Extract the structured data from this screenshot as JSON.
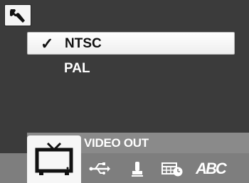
{
  "menu": {
    "options": [
      {
        "label": "NTSC",
        "selected": true,
        "check": "✓"
      },
      {
        "label": "PAL",
        "selected": false
      }
    ]
  },
  "infobar": {
    "label": "VIDEO OUT"
  },
  "tabs": [
    {
      "icon": "tv-icon",
      "active": true
    },
    {
      "icon": "usb-icon"
    },
    {
      "icon": "stamp-icon"
    },
    {
      "icon": "calendar-clock-icon"
    },
    {
      "icon": "abc-icon",
      "text": "ABC"
    }
  ],
  "colors": {
    "background": "#3b3b3b",
    "bar": "#7e7e7e",
    "selected": "#ffffff"
  }
}
